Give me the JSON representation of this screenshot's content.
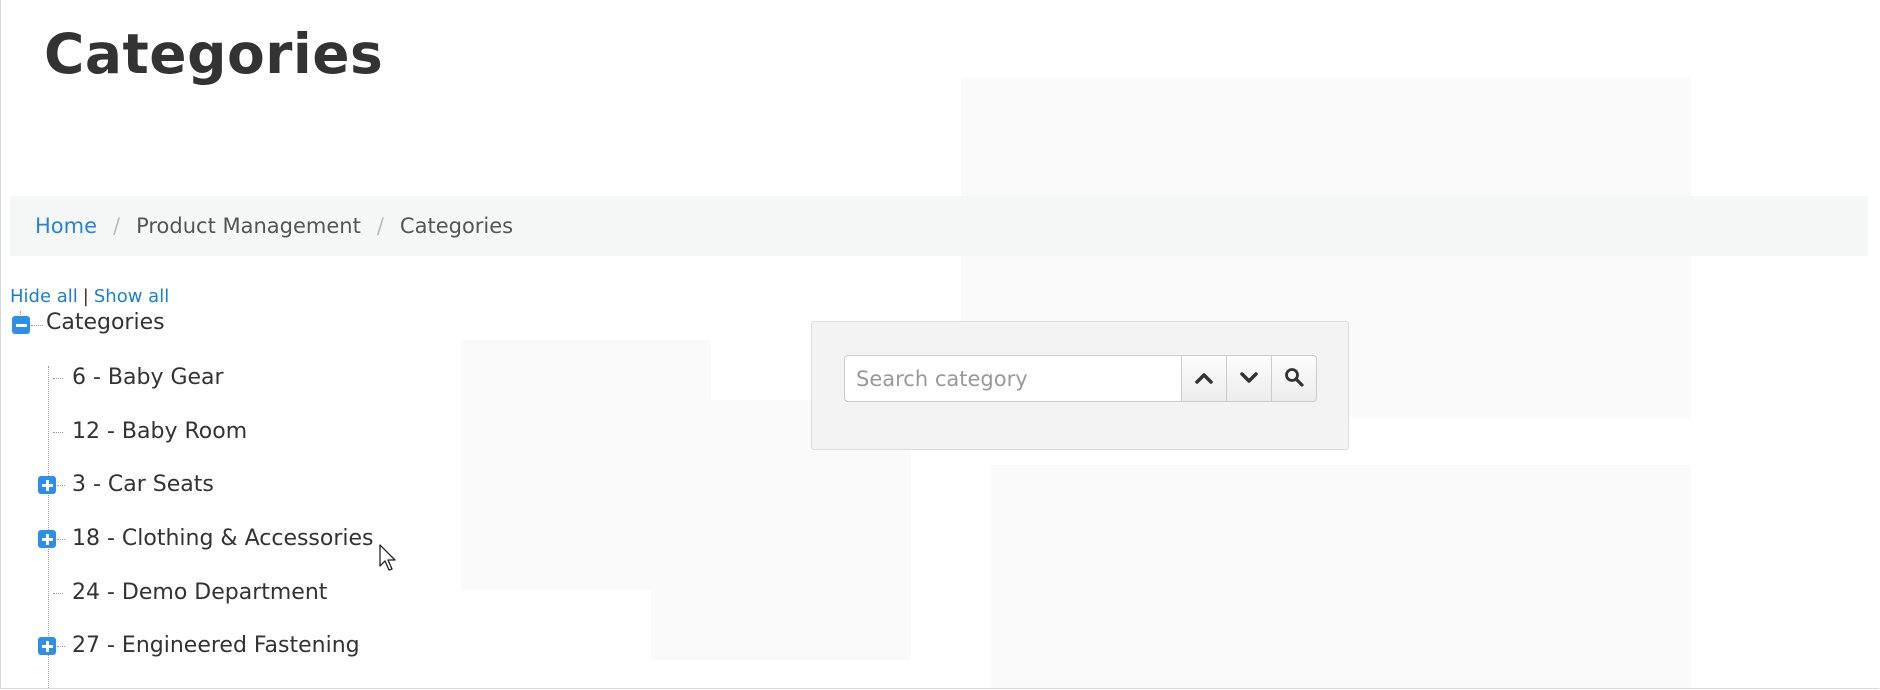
{
  "page": {
    "title": "Categories"
  },
  "breadcrumb": {
    "items": [
      {
        "label": "Home",
        "link": true
      },
      {
        "label": "Product Management",
        "link": false
      },
      {
        "label": "Categories",
        "link": false
      }
    ]
  },
  "tree_controls": {
    "hide_all": "Hide all",
    "separator": "|",
    "show_all": "Show all"
  },
  "tree": {
    "root": {
      "label": "Categories",
      "state": "expanded",
      "icon": "minus-icon"
    },
    "children": [
      {
        "label": "6 - Baby Gear",
        "expandable": false
      },
      {
        "label": "12 - Baby Room",
        "expandable": false
      },
      {
        "label": "3 - Car Seats",
        "expandable": true
      },
      {
        "label": "18 - Clothing & Accessories",
        "expandable": true
      },
      {
        "label": "24 - Demo Department",
        "expandable": false
      },
      {
        "label": "27 - Engineered Fastening",
        "expandable": true
      }
    ]
  },
  "search": {
    "placeholder": "Search category",
    "value": "",
    "buttons": [
      "chevron-up-icon",
      "chevron-down-icon",
      "search-icon"
    ]
  },
  "colors": {
    "link": "#2b83d5",
    "tree_icon": "#2f8ee8",
    "breadcrumb_bg": "#f5f6f6"
  }
}
